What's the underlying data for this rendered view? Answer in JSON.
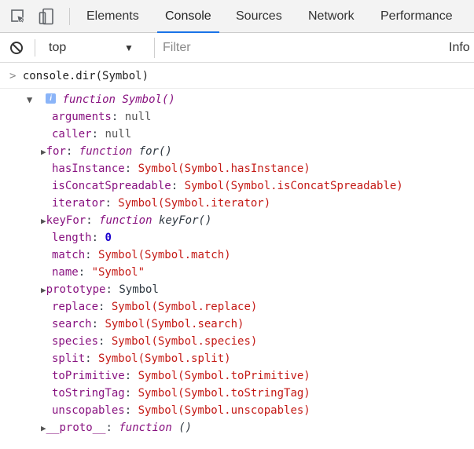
{
  "toolbar": {
    "tabs": [
      {
        "label": "Elements"
      },
      {
        "label": "Console",
        "active": true
      },
      {
        "label": "Sources"
      },
      {
        "label": "Network"
      },
      {
        "label": "Performance"
      }
    ]
  },
  "filterbar": {
    "context": "top",
    "filter_placeholder": "Filter",
    "level": "Info"
  },
  "console": {
    "input": "console.dir(Symbol)",
    "root": "function Symbol()",
    "props": [
      {
        "key": "arguments",
        "value": "null"
      },
      {
        "key": "caller",
        "value": "null"
      },
      {
        "key": "for",
        "value_kw": "function",
        "value_name": "for()"
      },
      {
        "key": "hasInstance",
        "value": "Symbol(Symbol.hasInstance)"
      },
      {
        "key": "isConcatSpreadable",
        "value": "Symbol(Symbol.isConcatSpreadable)"
      },
      {
        "key": "iterator",
        "value": "Symbol(Symbol.iterator)"
      },
      {
        "key": "keyFor",
        "value_kw": "function",
        "value_name": "keyFor()"
      },
      {
        "key": "length",
        "value": "0"
      },
      {
        "key": "match",
        "value": "Symbol(Symbol.match)"
      },
      {
        "key": "name",
        "value": "\"Symbol\""
      },
      {
        "key": "prototype",
        "value": "Symbol"
      },
      {
        "key": "replace",
        "value": "Symbol(Symbol.replace)"
      },
      {
        "key": "search",
        "value": "Symbol(Symbol.search)"
      },
      {
        "key": "species",
        "value": "Symbol(Symbol.species)"
      },
      {
        "key": "split",
        "value": "Symbol(Symbol.split)"
      },
      {
        "key": "toPrimitive",
        "value": "Symbol(Symbol.toPrimitive)"
      },
      {
        "key": "toStringTag",
        "value": "Symbol(Symbol.toStringTag)"
      },
      {
        "key": "unscopables",
        "value": "Symbol(Symbol.unscopables)"
      },
      {
        "key": "__proto__",
        "value_kw": "function",
        "value_name": "()"
      }
    ]
  }
}
